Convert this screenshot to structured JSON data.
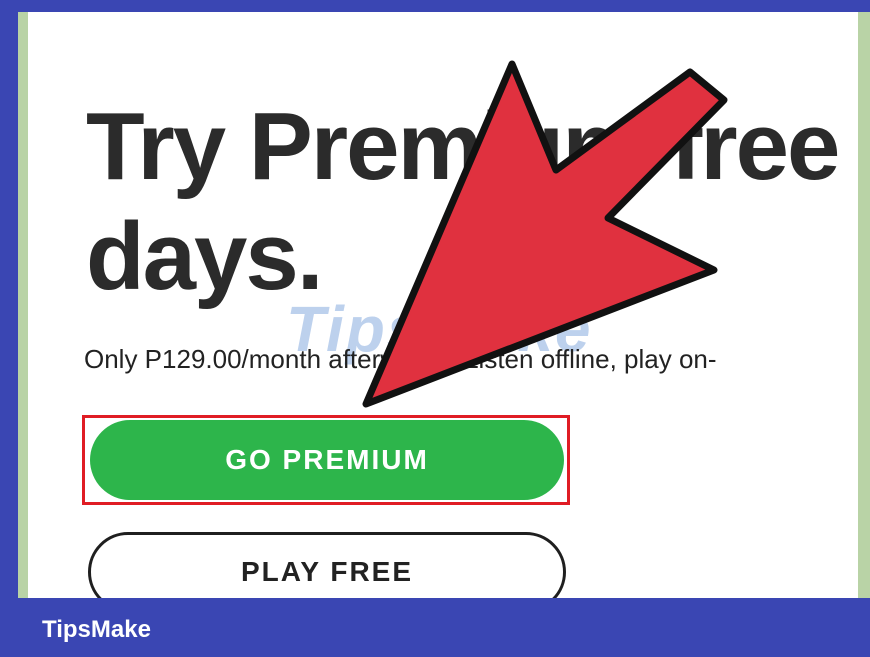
{
  "hero": {
    "headline_line1": "Try Premium free",
    "headline_line2": "days.",
    "subtext": "Only P129.00/month afterwards. Listen offline, play on-"
  },
  "buttons": {
    "go_premium_label": "GO PREMIUM",
    "play_free_label": "PLAY FREE"
  },
  "watermark": {
    "text": "TipsMake"
  },
  "footer": {
    "brand": "TipsMake"
  },
  "colors": {
    "frame_blue": "#3a46b3",
    "frame_green": "#b9d3a6",
    "premium_green": "#2db54b",
    "highlight_red": "#e01c24",
    "arrow_red": "#e0313f"
  }
}
